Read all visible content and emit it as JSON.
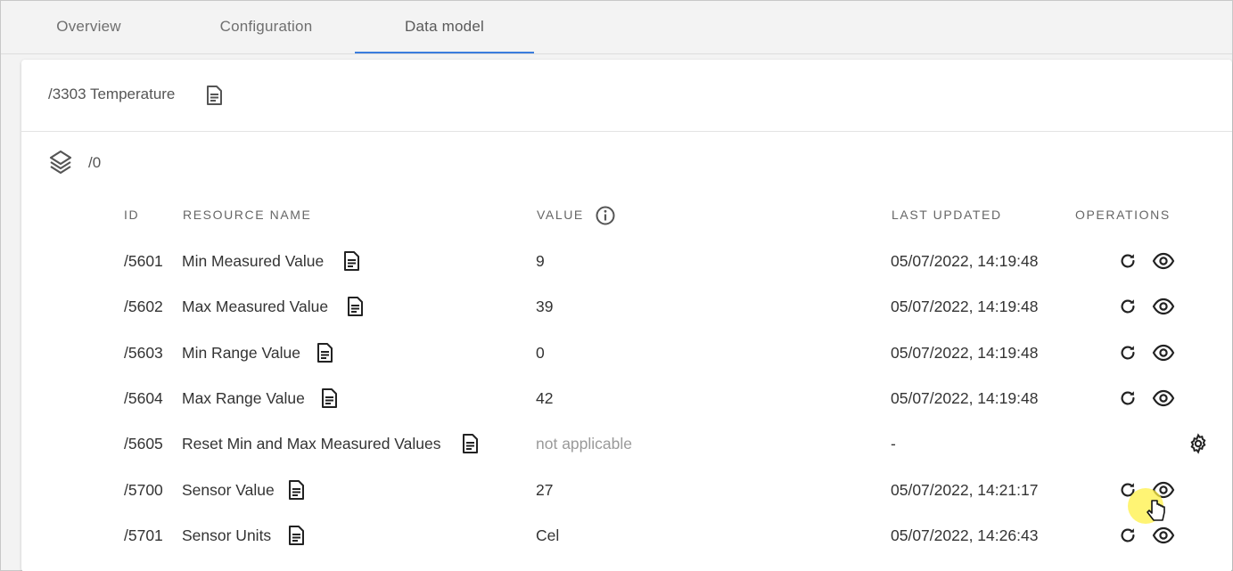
{
  "tabs": [
    {
      "label": "Overview",
      "active": false
    },
    {
      "label": "Configuration",
      "active": false
    },
    {
      "label": "Data model",
      "active": true
    }
  ],
  "object": {
    "title": "/3303 Temperature",
    "instance": "/0"
  },
  "table": {
    "headers": {
      "id": "ID",
      "name": "RESOURCE NAME",
      "value": "VALUE",
      "updated": "LAST UPDATED",
      "operations": "OPERATIONS"
    },
    "rows": [
      {
        "id": "/5601",
        "name": "Min Measured Value",
        "value": "9",
        "updated": "05/07/2022, 14:19:48",
        "ops": [
          "refresh-icon",
          "eye-icon"
        ]
      },
      {
        "id": "/5602",
        "name": "Max Measured Value",
        "value": "39",
        "updated": "05/07/2022, 14:19:48",
        "ops": [
          "refresh-icon",
          "eye-icon"
        ]
      },
      {
        "id": "/5603",
        "name": "Min Range Value",
        "value": "0",
        "updated": "05/07/2022, 14:19:48",
        "ops": [
          "refresh-icon",
          "eye-icon"
        ]
      },
      {
        "id": "/5604",
        "name": "Max Range Value",
        "value": "42",
        "updated": "05/07/2022, 14:19:48",
        "ops": [
          "refresh-icon",
          "eye-icon"
        ]
      },
      {
        "id": "/5605",
        "name": "Reset Min and Max Measured Values",
        "value": "not applicable",
        "updated": "-",
        "ops": [
          "execute-gear-icon"
        ]
      },
      {
        "id": "/5700",
        "name": "Sensor Value",
        "value": "27",
        "updated": "05/07/2022, 14:21:17",
        "ops": [
          "refresh-icon",
          "eye-icon"
        ]
      },
      {
        "id": "/5701",
        "name": "Sensor Units",
        "value": "Cel",
        "updated": "05/07/2022, 14:26:43",
        "ops": [
          "refresh-icon",
          "eye-icon"
        ]
      }
    ]
  },
  "colors": {
    "tab_active_underline": "#3b7ddd",
    "cursor_highlight": "#fff046"
  }
}
